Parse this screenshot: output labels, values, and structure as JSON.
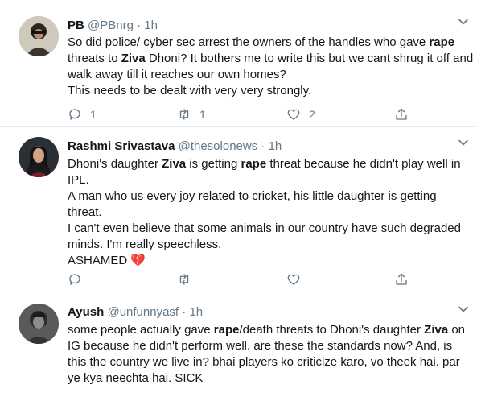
{
  "tweets": [
    {
      "name": "PB",
      "handle": "@PBnrg",
      "dot": "·",
      "time": "1h",
      "paragraphs": [
        [
          {
            "t": "So did police/ cyber sec arrest the owners of the handles who gave "
          },
          {
            "t": "rape",
            "b": true
          },
          {
            "t": " threats to "
          },
          {
            "t": "Ziva",
            "b": true
          },
          {
            "t": " Dhoni? It bothers me to write this but we cant shrug it off and walk away till it reaches our own homes?"
          }
        ],
        [
          {
            "t": "This needs to be dealt with very very strongly."
          }
        ]
      ],
      "reply_count": "1",
      "retweet_count": "1",
      "like_count": "2"
    },
    {
      "name": "Rashmi Srivastava",
      "handle": "@thesolonews",
      "dot": "·",
      "time": "1h",
      "paragraphs": [
        [
          {
            "t": "Dhoni's daughter "
          },
          {
            "t": "Ziva",
            "b": true
          },
          {
            "t": " is getting "
          },
          {
            "t": "rape",
            "b": true
          },
          {
            "t": " threat because he didn't play well in IPL."
          }
        ],
        [
          {
            "t": "A man who us every joy related to cricket, his little daughter is getting threat."
          }
        ],
        [
          {
            "t": "I can't even believe that some animals in our country have such degraded minds. I'm really speechless."
          }
        ],
        [
          {
            "t": "ASHAMED "
          },
          {
            "t": "💔",
            "emoji": true
          }
        ]
      ],
      "reply_count": "",
      "retweet_count": "",
      "like_count": ""
    },
    {
      "name": "Ayush",
      "handle": "@unfunnyasf",
      "dot": "·",
      "time": "1h",
      "paragraphs": [
        [
          {
            "t": "some people actually gave "
          },
          {
            "t": "rape",
            "b": true
          },
          {
            "t": "/death threats to Dhoni's daughter "
          },
          {
            "t": "Ziva",
            "b": true
          },
          {
            "t": " on IG because he didn't perform well. are these the standards now? And, is this the country we live in? bhai players ko criticize karo, vo theek hai. par ye kya neechta hai. SICK"
          }
        ]
      ]
    }
  ],
  "colors": {
    "text": "#14171a",
    "muted": "#657786",
    "divider": "#e6ecf0",
    "heart_emoji": "#c2185b"
  },
  "icons": [
    "reply-icon",
    "retweet-icon",
    "like-icon",
    "share-icon",
    "chevron-down-icon",
    "broken-heart-emoji"
  ]
}
